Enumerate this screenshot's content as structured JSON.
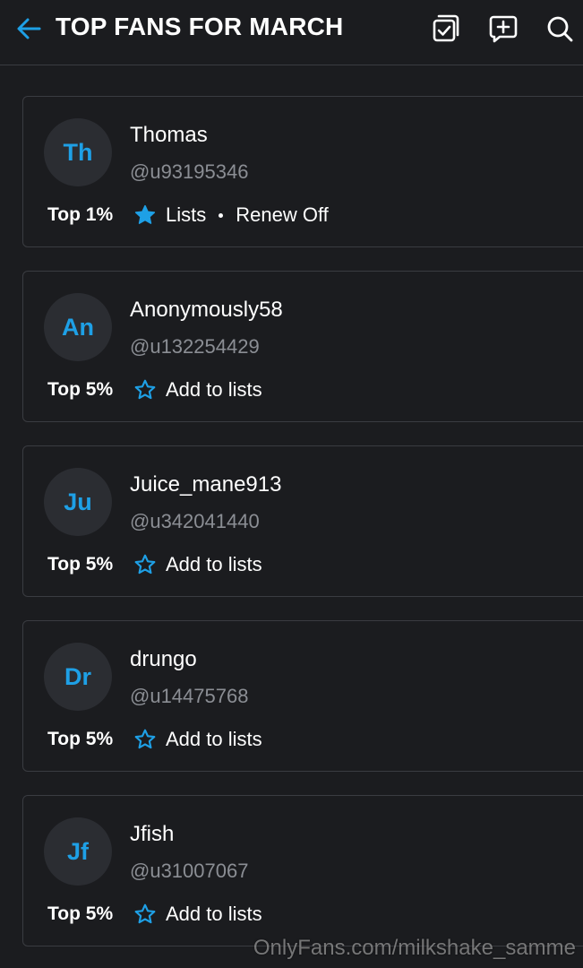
{
  "header": {
    "title": "TOP FANS FOR MARCH",
    "back_icon": "arrow-left-icon",
    "actions": [
      "select-checkbox-icon",
      "add-list-icon",
      "search-icon"
    ]
  },
  "colors": {
    "accent": "#1ea0e6",
    "background": "#1b1c1f",
    "card_border": "#3a3c41",
    "muted_text": "#8b8e94"
  },
  "fans": [
    {
      "initials": "Th",
      "name": "Thomas",
      "handle": "@u93195346",
      "rank": "Top 1%",
      "lists_label": "Lists",
      "in_lists": true,
      "renew": "Renew Off"
    },
    {
      "initials": "An",
      "name": "Anonymously58",
      "handle": "@u132254429",
      "rank": "Top 5%",
      "lists_label": "Add to lists",
      "in_lists": false,
      "renew": ""
    },
    {
      "initials": "Ju",
      "name": "Juice_mane913",
      "handle": "@u342041440",
      "rank": "Top 5%",
      "lists_label": "Add to lists",
      "in_lists": false,
      "renew": ""
    },
    {
      "initials": "Dr",
      "name": "drungo",
      "handle": "@u14475768",
      "rank": "Top 5%",
      "lists_label": "Add to lists",
      "in_lists": false,
      "renew": ""
    },
    {
      "initials": "Jf",
      "name": "Jfish",
      "handle": "@u31007067",
      "rank": "Top 5%",
      "lists_label": "Add to lists",
      "in_lists": false,
      "renew": ""
    }
  ],
  "watermark": "OnlyFans.com/milkshake_samme"
}
